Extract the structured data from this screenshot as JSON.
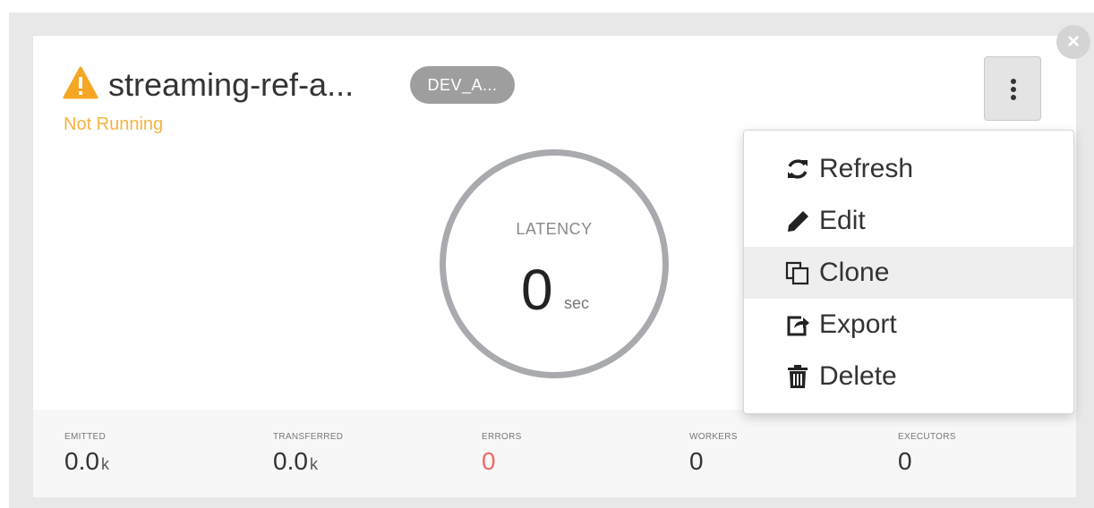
{
  "topology": {
    "title": "streaming-ref-a...",
    "env_badge": "DEV_A...",
    "status": "Not Running",
    "status_color": "#f5b342"
  },
  "close_icon": "close-icon",
  "latency": {
    "label": "LATENCY",
    "value": "0",
    "unit": "sec"
  },
  "stats": [
    {
      "label": "EMITTED",
      "value": "0.0",
      "unit": "k"
    },
    {
      "label": "TRANSFERRED",
      "value": "0.0",
      "unit": "k"
    },
    {
      "label": "ERRORS",
      "value": "0",
      "unit": "",
      "color": "#ee6a6a"
    },
    {
      "label": "WORKERS",
      "value": "0",
      "unit": ""
    },
    {
      "label": "EXECUTORS",
      "value": "0",
      "unit": ""
    }
  ],
  "menu": {
    "items": [
      {
        "label": "Refresh",
        "icon": "refresh-icon"
      },
      {
        "label": "Edit",
        "icon": "pencil-icon"
      },
      {
        "label": "Clone",
        "icon": "clone-icon",
        "highlighted": true
      },
      {
        "label": "Export",
        "icon": "export-icon"
      },
      {
        "label": "Delete",
        "icon": "trash-icon"
      }
    ]
  }
}
